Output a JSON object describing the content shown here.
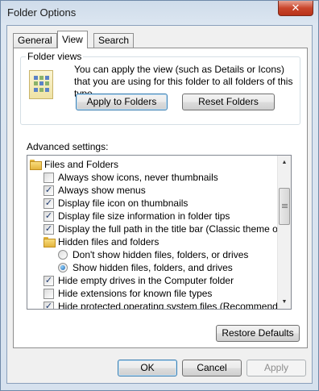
{
  "window": {
    "title": "Folder Options",
    "close_glyph": "✕"
  },
  "tabs": [
    {
      "label": "General",
      "active": false
    },
    {
      "label": "View",
      "active": true
    },
    {
      "label": "Search",
      "active": false
    }
  ],
  "folder_views": {
    "legend": "Folder views",
    "description": "You can apply the view (such as Details or Icons) that you are using for this folder to all folders of this type.",
    "apply_label": "Apply to Folders",
    "reset_label": "Reset Folders"
  },
  "advanced": {
    "label": "Advanced settings:",
    "items": [
      {
        "type": "folder",
        "label": "Files and Folders"
      },
      {
        "type": "checkbox",
        "label": "Always show icons, never thumbnails",
        "checked": false
      },
      {
        "type": "checkbox",
        "label": "Always show menus",
        "checked": true
      },
      {
        "type": "checkbox",
        "label": "Display file icon on thumbnails",
        "checked": true
      },
      {
        "type": "checkbox",
        "label": "Display file size information in folder tips",
        "checked": true
      },
      {
        "type": "checkbox",
        "label": "Display the full path in the title bar (Classic theme only)",
        "checked": true
      },
      {
        "type": "folder",
        "label": "Hidden files and folders"
      },
      {
        "type": "radio",
        "label": "Don't show hidden files, folders, or drives",
        "checked": false
      },
      {
        "type": "radio",
        "label": "Show hidden files, folders, and drives",
        "checked": true
      },
      {
        "type": "checkbox",
        "label": "Hide empty drives in the Computer folder",
        "checked": true
      },
      {
        "type": "checkbox",
        "label": "Hide extensions for known file types",
        "checked": false
      },
      {
        "type": "checkbox",
        "label": "Hide protected operating system files (Recommended)",
        "checked": true
      }
    ],
    "check_glyph": "✓",
    "restore_label": "Restore Defaults"
  },
  "footer": {
    "ok_label": "OK",
    "cancel_label": "Cancel",
    "apply_label": "Apply",
    "apply_enabled": false
  }
}
